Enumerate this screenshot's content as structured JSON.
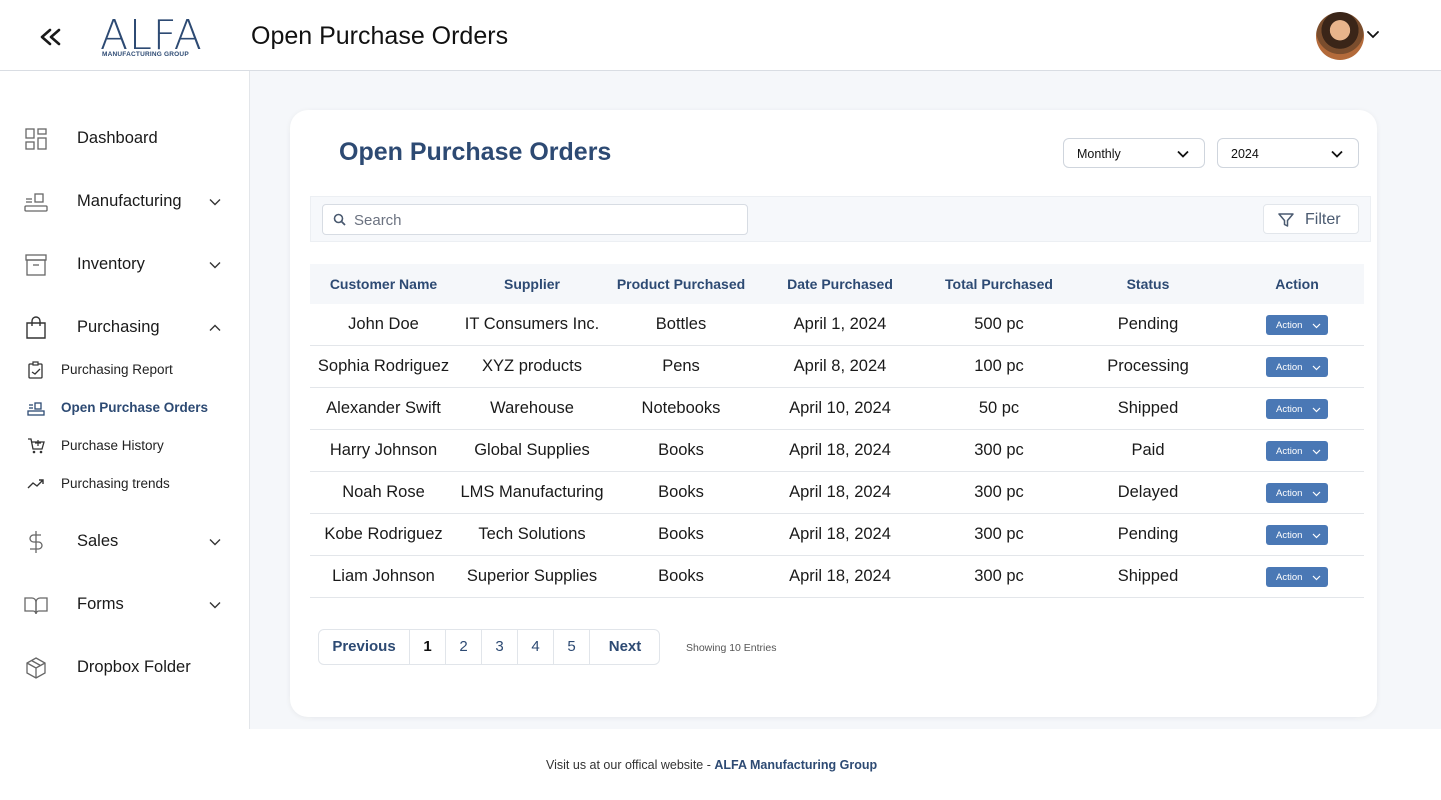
{
  "header": {
    "logo_main": "ALFA",
    "logo_sub": "MANUFACTURING GROUP",
    "page_title": "Open Purchase Orders"
  },
  "sidebar": {
    "items": [
      {
        "label": "Dashboard",
        "icon": "dashboard-icon"
      },
      {
        "label": "Manufacturing",
        "icon": "manufacturing-icon"
      },
      {
        "label": "Inventory",
        "icon": "archive-icon"
      },
      {
        "label": "Purchasing",
        "icon": "shopping-bag-icon"
      },
      {
        "label": "Sales",
        "icon": "dollar-icon"
      },
      {
        "label": "Forms",
        "icon": "book-open-icon"
      },
      {
        "label": "Dropbox Folder",
        "icon": "box-icon"
      }
    ],
    "purchasing_sub": [
      {
        "label": "Purchasing Report",
        "icon": "clipboard-icon"
      },
      {
        "label": "Open Purchase Orders",
        "icon": "conveyor-icon",
        "active": true
      },
      {
        "label": "Purchase History",
        "icon": "cart-icon"
      },
      {
        "label": "Purchasing trends",
        "icon": "trend-up-icon"
      }
    ]
  },
  "card": {
    "title": "Open Purchase Orders",
    "period_select": "Monthly",
    "year_select": "2024",
    "search_placeholder": "Search",
    "filter_label": "Filter"
  },
  "table": {
    "columns": [
      "Customer Name",
      "Supplier",
      "Product Purchased",
      "Date Purchased",
      "Total Purchased",
      "Status",
      "Action"
    ],
    "rows": [
      {
        "customer": "John Doe",
        "supplier": "IT Consumers Inc.",
        "product": "Bottles",
        "date": "April 1, 2024",
        "total": "500 pc",
        "status": "Pending",
        "action": "Action"
      },
      {
        "customer": "Sophia Rodriguez",
        "supplier": "XYZ products",
        "product": "Pens",
        "date": "April 8, 2024",
        "total": "100 pc",
        "status": "Processing",
        "action": "Action"
      },
      {
        "customer": "Alexander Swift",
        "supplier": "Warehouse",
        "product": "Notebooks",
        "date": "April 10, 2024",
        "total": "50 pc",
        "status": "Shipped",
        "action": "Action"
      },
      {
        "customer": "Harry Johnson",
        "supplier": "Global Supplies",
        "product": "Books",
        "date": "April 18, 2024",
        "total": "300 pc",
        "status": "Paid",
        "action": "Action"
      },
      {
        "customer": "Noah Rose",
        "supplier": "LMS Manufacturing",
        "product": "Books",
        "date": "April 18, 2024",
        "total": "300 pc",
        "status": "Delayed",
        "action": "Action"
      },
      {
        "customer": "Kobe Rodriguez",
        "supplier": "Tech Solutions",
        "product": "Books",
        "date": "April 18, 2024",
        "total": "300 pc",
        "status": "Pending",
        "action": "Action"
      },
      {
        "customer": "Liam Johnson",
        "supplier": "Superior Supplies",
        "product": "Books",
        "date": "April 18, 2024",
        "total": "300 pc",
        "status": "Shipped",
        "action": "Action"
      }
    ]
  },
  "pagination": {
    "previous": "Previous",
    "pages": [
      "1",
      "2",
      "3",
      "4",
      "5"
    ],
    "current": "1",
    "next": "Next",
    "entries_text": "Showing 10 Entries"
  },
  "footer": {
    "text": "Visit us at our offical website - ",
    "link": "ALFA Manufacturing Group"
  },
  "colors": {
    "brand": "#2d4a73",
    "action_button": "#4a78b5"
  }
}
